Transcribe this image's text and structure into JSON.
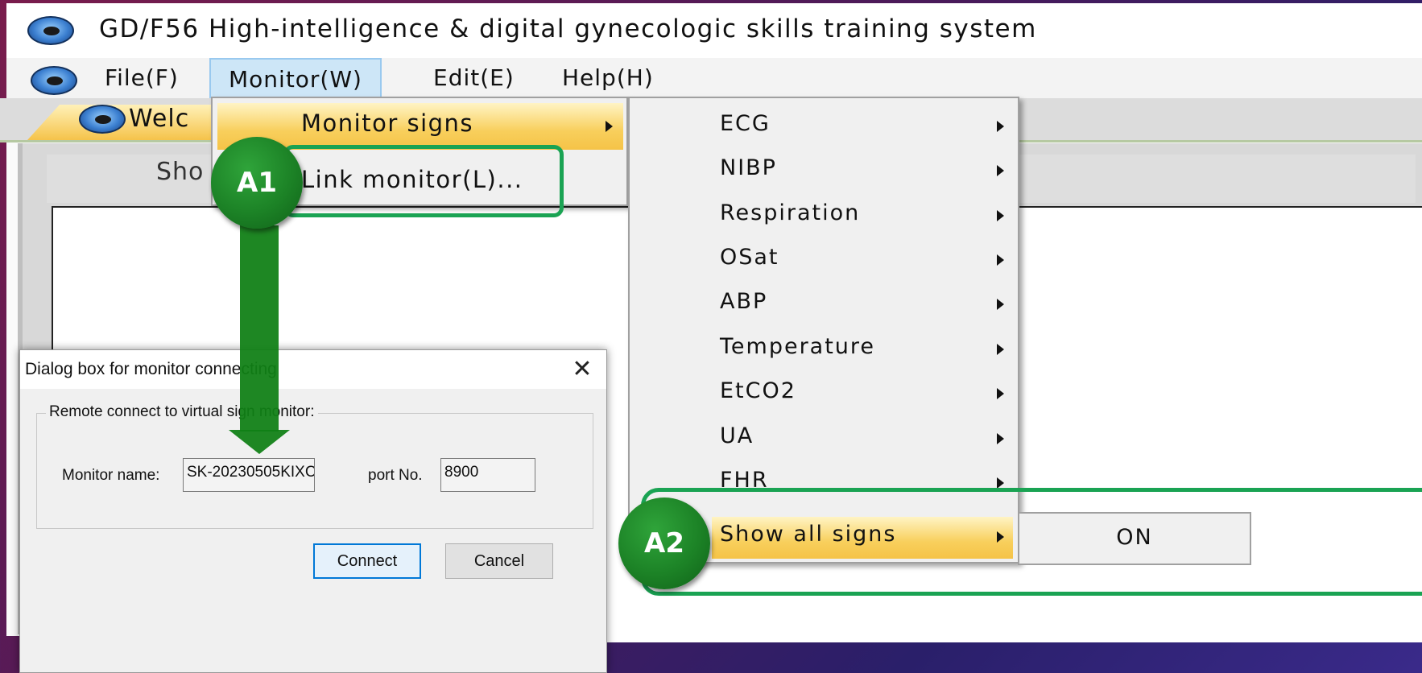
{
  "window": {
    "title": "GD/F56 High-intelligence & digital gynecologic skills training system"
  },
  "menubar": {
    "file": "File(F)",
    "monitor": "Monitor(W)",
    "edit": "Edit(E)",
    "help": "Help(H)"
  },
  "tab": {
    "label": "Welc"
  },
  "panel": {
    "header": "Sho"
  },
  "monitor_menu": {
    "item1": "Monitor signs",
    "item2": "Link monitor(L)..."
  },
  "signs_submenu": {
    "items": [
      "ECG",
      "NIBP",
      "Respiration",
      "OSat",
      "ABP",
      "Temperature",
      "EtCO2",
      "UA",
      "FHR"
    ],
    "show_all": "Show all signs"
  },
  "show_all_submenu": {
    "on": "ON"
  },
  "dialog": {
    "title": "Dialog box for monitor connecting",
    "group_label": "Remote connect to virtual sign monitor:",
    "monitor_name_label": "Monitor name:",
    "monitor_name_value": "SK-20230505KIXC",
    "port_label": "port No.",
    "port_value": "8900",
    "connect": "Connect",
    "cancel": "Cancel",
    "close_glyph": "✕"
  },
  "annotations": {
    "a1": "A1",
    "a2": "A2"
  },
  "colors": {
    "accent_green": "#1aa353",
    "menu_highlight": "#f8cf5c",
    "active_menu": "#cde6f7"
  }
}
